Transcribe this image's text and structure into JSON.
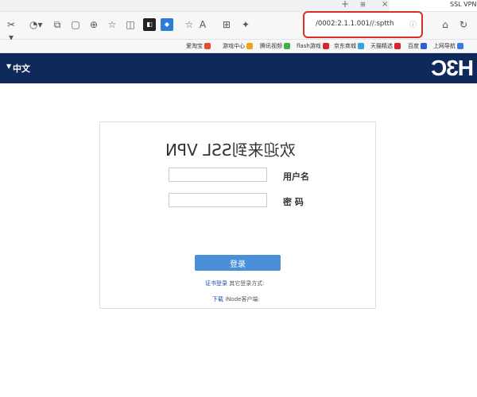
{
  "tab": {
    "title": "SSL VPN",
    "close": "×",
    "new": "+",
    "icon_text": "⊞"
  },
  "toolbar": {
    "address": "https://100.1.1.2:2000/",
    "icons": [
      "refresh-icon",
      "home-icon",
      "address-info-icon",
      "pin-icon",
      "split-icon",
      "favorites-icon",
      "collections-icon",
      "extension-blue-icon",
      "extension-dark-icon",
      "bookmark-icon",
      "download-icon",
      "screenshot-icon",
      "history-icon",
      "settings-icon",
      "tab-icon"
    ]
  },
  "bookmarks": {
    "items": [
      "上网导航",
      "百度",
      "天猫精选",
      "京东商城",
      "flash游戏",
      "腾讯视频",
      "游戏中心",
      "爱淘宝"
    ]
  },
  "header": {
    "language": "中文",
    "logo": "H3C"
  },
  "login": {
    "title": "欢迎来到SSL VPN",
    "username_label": "用户名",
    "password_label": "密 码",
    "username_value": "",
    "password_value": "",
    "login_button": "登录",
    "other_login_prefix": "其它登录方式:",
    "other_login_link": "证书登录",
    "client_prefix": "iNode客户端:",
    "client_link": "下载"
  },
  "colors": {
    "header_bg": "#0f2a5a",
    "button_bg": "#4a90d9",
    "highlight": "#d93025"
  }
}
